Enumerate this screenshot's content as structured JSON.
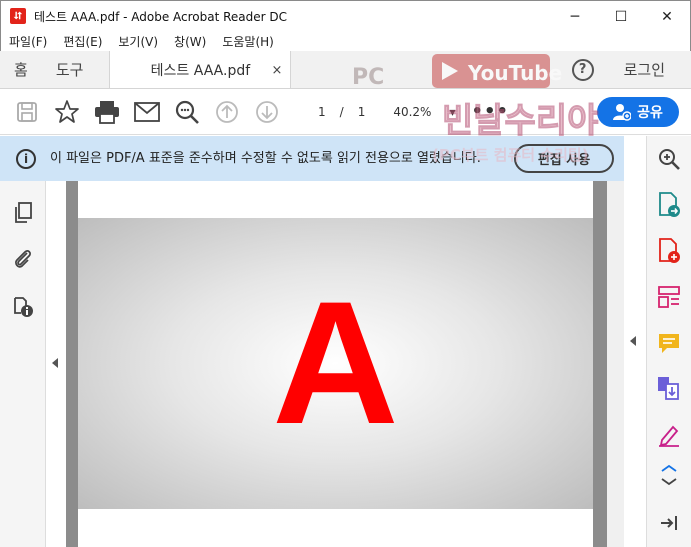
{
  "window": {
    "title": "테스트 AAA.pdf - Adobe Acrobat Reader DC",
    "app_icon": "acrobat-icon",
    "controls": [
      "─",
      "☐",
      "✕"
    ]
  },
  "menu": [
    "파일(F)",
    "편집(E)",
    "보기(V)",
    "창(W)",
    "도움말(H)"
  ],
  "tabs": {
    "home": "홈",
    "tools": "도구",
    "document": "테스트 AAA.pdf",
    "close": "×",
    "help": "?",
    "login": "로그인"
  },
  "toolbar": {
    "page_current": "1",
    "page_sep": "/",
    "page_total": "1",
    "zoom": "40.2%",
    "zoom_caret": "▾",
    "more": "•••",
    "share": "공유"
  },
  "infobar": {
    "icon": "i",
    "message": "이 파일은 PDF/A 표준을 준수하며 수정할 수 없도록 읽기 전용으로 열렸습니다.",
    "edit_button": "편집 사용"
  },
  "document": {
    "glyph": "A",
    "glyph_color": "#ff0000"
  },
  "watermark": {
    "pc": "PC",
    "youtube": "YouTube",
    "main": "빈날수리야",
    "sub": "(PC부트 컴퓨터 수리팁)"
  },
  "colors": {
    "accent": "#1473e6",
    "info_bg": "#cfe4f7",
    "doc_bg": "#8c8c8c"
  }
}
